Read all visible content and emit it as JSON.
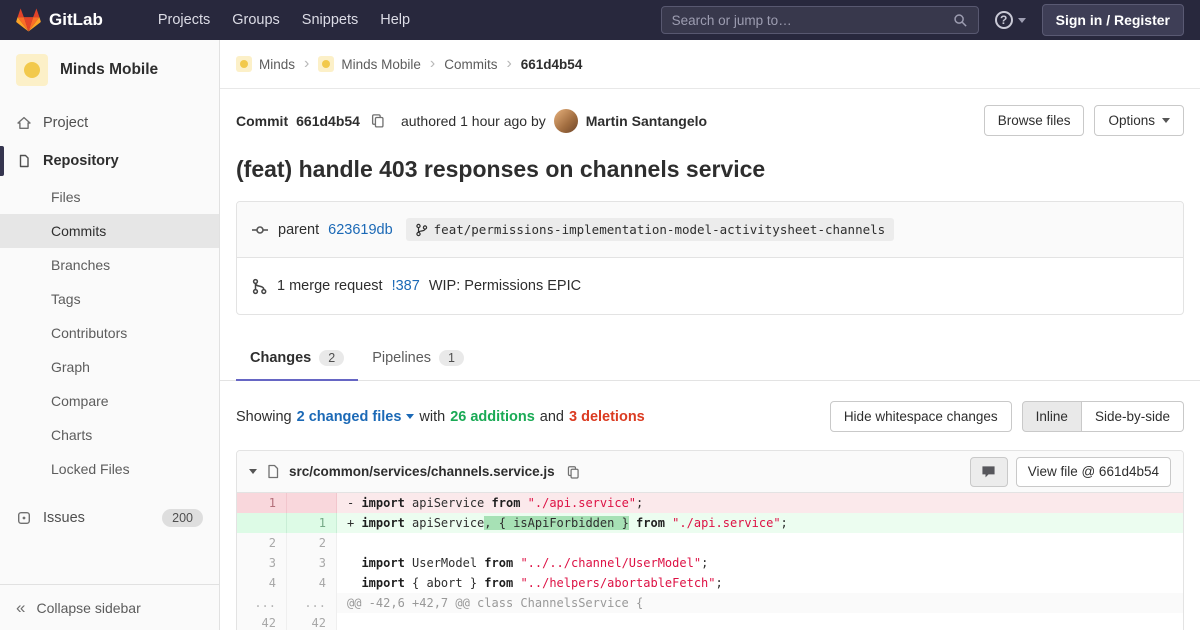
{
  "navbar": {
    "brand": "GitLab",
    "menu": [
      "Projects",
      "Groups",
      "Snippets",
      "Help"
    ],
    "search_placeholder": "Search or jump to…",
    "sign_in": "Sign in / Register"
  },
  "sidebar": {
    "project_name": "Minds Mobile",
    "project_item": "Project",
    "repository_item": "Repository",
    "repo_items": [
      "Files",
      "Commits",
      "Branches",
      "Tags",
      "Contributors",
      "Graph",
      "Compare",
      "Charts",
      "Locked Files"
    ],
    "active_repo_item": "Commits",
    "issues_label": "Issues",
    "issues_count": "200",
    "collapse_label": "Collapse sidebar"
  },
  "breadcrumb": {
    "minds": "Minds",
    "minds_mobile": "Minds Mobile",
    "commits": "Commits",
    "current": "661d4b54"
  },
  "commit": {
    "label": "Commit",
    "sha": "661d4b54",
    "authored": "authored 1 hour ago by",
    "author": "Martin Santangelo",
    "browse_files": "Browse files",
    "options": "Options",
    "title": "(feat) handle 403 responses on channels service",
    "parent_label": "parent",
    "parent_sha": "623619db",
    "branch_ref": "feat/permissions-implementation-model-activitysheet-channels",
    "mr_count_text": "1 merge request",
    "mr_ref": "!387",
    "mr_title": "WIP: Permissions EPIC"
  },
  "tabs": {
    "changes_label": "Changes",
    "changes_count": "2",
    "pipelines_label": "Pipelines",
    "pipelines_count": "1"
  },
  "summary": {
    "showing": "Showing",
    "files_dropdown": "2 changed files",
    "with": "with",
    "additions": "26 additions",
    "and": "and",
    "deletions": "3 deletions",
    "hide_whitespace": "Hide whitespace changes",
    "inline": "Inline",
    "side_by_side": "Side-by-side"
  },
  "diff": {
    "file_path": "src/common/services/channels.service.js",
    "view_file": "View file @ 661d4b54",
    "rows": [
      {
        "old": "1",
        "new": "",
        "type": "removed",
        "tokens": [
          [
            "sign",
            "- "
          ],
          [
            "kw",
            "import"
          ],
          [
            "p",
            " apiService "
          ],
          [
            "kw",
            "from"
          ],
          [
            "p",
            " "
          ],
          [
            "str",
            "\"./api.service\""
          ],
          [
            "p",
            ";"
          ]
        ]
      },
      {
        "old": "",
        "new": "1",
        "type": "added",
        "tokens": [
          [
            "sign",
            "+ "
          ],
          [
            "kw",
            "import"
          ],
          [
            "p",
            " apiService"
          ],
          [
            "hl",
            ", { isApiForbidden }"
          ],
          [
            "p",
            " "
          ],
          [
            "kw",
            "from"
          ],
          [
            "p",
            " "
          ],
          [
            "str",
            "\"./api.service\""
          ],
          [
            "p",
            ";"
          ]
        ]
      },
      {
        "old": "2",
        "new": "2",
        "type": "context",
        "tokens": []
      },
      {
        "old": "3",
        "new": "3",
        "type": "context",
        "tokens": [
          [
            "p",
            "  "
          ],
          [
            "kw",
            "import"
          ],
          [
            "p",
            " UserModel "
          ],
          [
            "kw",
            "from"
          ],
          [
            "p",
            " "
          ],
          [
            "str",
            "\"../../channel/UserModel\""
          ],
          [
            "p",
            ";"
          ]
        ]
      },
      {
        "old": "4",
        "new": "4",
        "type": "context",
        "tokens": [
          [
            "p",
            "  "
          ],
          [
            "kw",
            "import"
          ],
          [
            "p",
            " { abort } "
          ],
          [
            "kw",
            "from"
          ],
          [
            "p",
            " "
          ],
          [
            "str",
            "\"../helpers/abortableFetch\""
          ],
          [
            "p",
            ";"
          ]
        ]
      },
      {
        "old": "...",
        "new": "...",
        "type": "match",
        "tokens": [
          [
            "match",
            "@@ -42,6 +42,7 @@ class ChannelsService {"
          ]
        ]
      },
      {
        "old": "42",
        "new": "42",
        "type": "context",
        "tokens": []
      }
    ]
  },
  "colors": {
    "navbar_bg": "#28283d",
    "accent_tab": "#6666c4",
    "link": "#1b69b6",
    "additions_green": "#1aaa55",
    "deletions_red": "#db3b21"
  }
}
